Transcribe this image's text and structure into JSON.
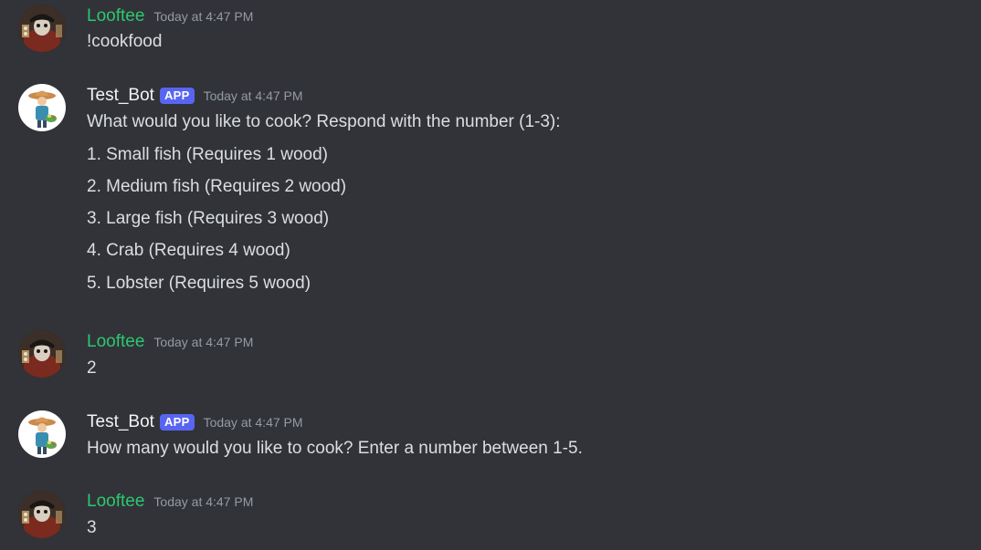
{
  "colors": {
    "background": "#313338",
    "looftee_name": "#2dc770",
    "bot_name": "#f2f3f5",
    "app_badge": "#5865f2",
    "timestamp": "#949ba4",
    "message_text": "#dbdee1"
  },
  "messages": [
    {
      "author": "Looftee",
      "avatar_icon": "pirate-avatar-icon",
      "timestamp": "Today at 4:47 PM",
      "lines": [
        "!cookfood"
      ]
    },
    {
      "author": "Test_Bot",
      "badge": "APP",
      "avatar_icon": "fisherman-avatar-icon",
      "timestamp": "Today at 4:47 PM",
      "lines": [
        "What would you like to cook? Respond with the number (1-3):",
        "1. Small fish (Requires 1 wood)",
        "2. Medium fish (Requires 2 wood)",
        "3. Large fish (Requires 3 wood)",
        "4. Crab (Requires 4 wood)",
        "5. Lobster (Requires 5 wood)"
      ]
    },
    {
      "author": "Looftee",
      "avatar_icon": "pirate-avatar-icon",
      "timestamp": "Today at 4:47 PM",
      "lines": [
        "2"
      ]
    },
    {
      "author": "Test_Bot",
      "badge": "APP",
      "avatar_icon": "fisherman-avatar-icon",
      "timestamp": "Today at 4:47 PM",
      "lines": [
        "How many would you like to cook? Enter a number between 1-5."
      ]
    },
    {
      "author": "Looftee",
      "avatar_icon": "pirate-avatar-icon",
      "timestamp": "Today at 4:47 PM",
      "lines": [
        "3"
      ]
    }
  ]
}
